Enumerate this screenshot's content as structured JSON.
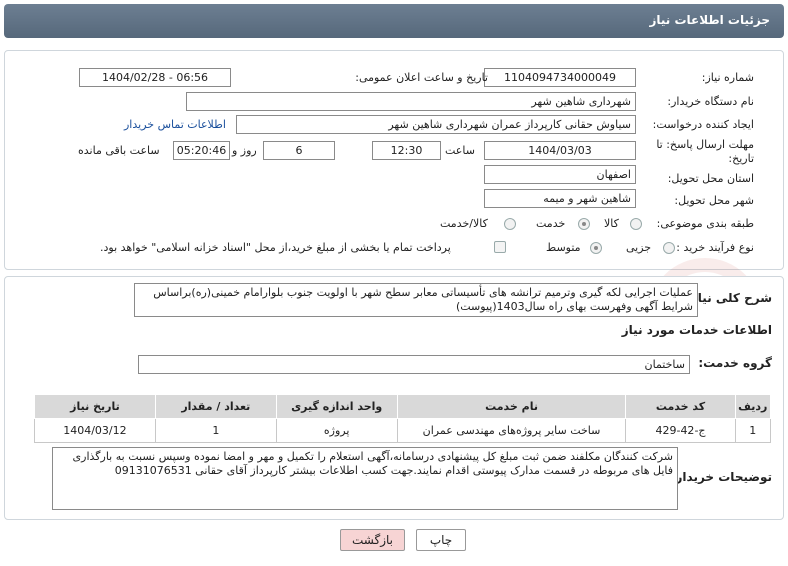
{
  "header": {
    "title": "جزئیات اطلاعات نیاز"
  },
  "fields": {
    "need_number_label": "شماره نیاز:",
    "need_number": "1104094734000049",
    "announce_label": "تاریخ و ساعت اعلان عمومی:",
    "announce_value": "1404/02/28 - 06:56",
    "buyer_org_label": "نام دستگاه خریدار:",
    "buyer_org": "شهرداری شاهین شهر",
    "creator_label": "ایجاد کننده درخواست:",
    "creator": "سیاوش حقانی کارپرداز عمران شهرداری شاهین شهر",
    "contact_link": "اطلاعات تماس خریدار",
    "deadline_label_1": "مهلت ارسال پاسخ: تا",
    "deadline_label_2": "تاریخ:",
    "deadline_date": "1404/03/03",
    "time_label": "ساعت",
    "deadline_time": "12:30",
    "days": "6",
    "days_label": "روز و",
    "remaining_time": "05:20:46",
    "remaining_label": "ساعت باقی مانده",
    "province_label": "استان محل تحویل:",
    "province": "اصفهان",
    "city_label": "شهر محل تحویل:",
    "city": "شاهین شهر و میمه",
    "category_label": "طبقه بندی موضوعی:",
    "category_options": [
      "کالا",
      "خدمت",
      "کالا/خدمت"
    ],
    "category_selected": "خدمت",
    "process_label": "نوع فرآیند خرید :",
    "process_options": [
      "جزیی",
      "متوسط"
    ],
    "process_selected": "متوسط",
    "payment_note": "پرداخت تمام یا بخشی از مبلغ خرید،از محل \"اسناد خزانه اسلامی\" خواهد بود."
  },
  "description": {
    "label": "شرح کلی نیاز:",
    "text": "عملیات اجرایی لکه گیری وترمیم ترانشه های تأسیساتی معابر سطح شهر با اولویت جنوب بلوارامام خمینی(ره)براساس شرایط آگهی وفهرست بهای راه سال1403(پیوست)"
  },
  "services": {
    "section_title": "اطلاعات خدمات مورد نیاز",
    "group_label": "گروه خدمت:",
    "group_value": "ساختمان",
    "columns": [
      "ردیف",
      "کد خدمت",
      "نام خدمت",
      "واحد اندازه گیری",
      "تعداد / مقدار",
      "تاریخ نیاز"
    ],
    "rows": [
      [
        "1",
        "ج-42-429",
        "ساخت سایر پروژه‌های مهندسی عمران",
        "پروژه",
        "1",
        "1404/03/12"
      ]
    ]
  },
  "buyer_notes": {
    "label": "توضیحات خریدار:",
    "text": "شرکت کنندگان مکلفند ضمن ثبت مبلغ کل پیشنهادی درسامانه،آگهی استعلام را  تکمیل و مهر و امضا نموده وسپس نسبت به بارگذاری فایل های مربوطه در قسمت مدارک پیوستی اقدام نمایند.جهت کسب اطلاعات بیشتر کارپرداز آقای حقانی 09131076531"
  },
  "buttons": {
    "print": "چاپ",
    "back": "بازگشت"
  },
  "watermark": {
    "text": "AriaTender.net"
  },
  "colors": {
    "header": "#5f7185",
    "link": "#1a4f9c",
    "back_button": "#f7d4d4",
    "table_header": "#d9d9d9"
  }
}
